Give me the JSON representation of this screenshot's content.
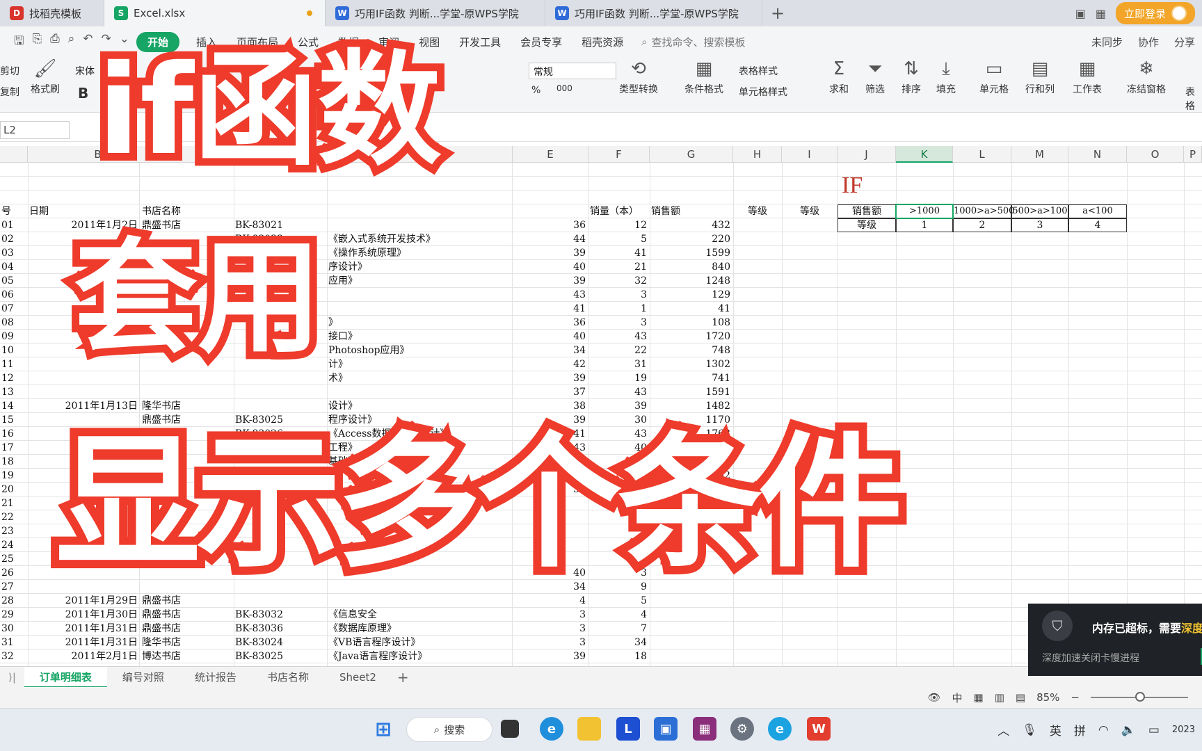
{
  "tabs": [
    {
      "label": "找稻壳模板",
      "icon": "D",
      "color": "#d9342b"
    },
    {
      "label": "Excel.xlsx",
      "icon": "S",
      "color": "#16a564"
    },
    {
      "label": "巧用IF函数 判断...学堂-原WPS学院",
      "icon": "W",
      "color": "#2f6bd8"
    },
    {
      "label": "巧用IF函数 判断...学堂-原WPS学院",
      "icon": "W",
      "color": "#2f6bd8"
    }
  ],
  "login_label": "立即登录",
  "menu": [
    "开始",
    "插入",
    "页面布局",
    "公式",
    "数据",
    "审阅",
    "视图",
    "开发工具",
    "会员专享",
    "稻壳资源"
  ],
  "search_placeholder": "查找命令、搜索模板",
  "menu_right": [
    "未同步",
    "协作",
    "分享"
  ],
  "ribbon": {
    "cut": "剪切",
    "copy": "复制",
    "format_painter": "格式刷",
    "font": "宋体",
    "bold": "B",
    "number_format": "常规",
    "type_convert": "类型转换",
    "cond_format": "条件格式",
    "table_style": "表格样式",
    "cell_style": "单元格样式",
    "sum": "求和",
    "filter": "筛选",
    "sort": "排序",
    "fill": "填充",
    "cell": "单元格",
    "row_col": "行和列",
    "worksheet": "工作表",
    "freeze": "冻结窗格",
    "table": "表格",
    "pct": "%",
    "thousand": "000"
  },
  "name_box": "L2",
  "columns": [
    "B",
    "E",
    "F",
    "G",
    "H",
    "I",
    "J",
    "K",
    "L",
    "M",
    "N",
    "O",
    "P"
  ],
  "header_row": {
    "a": "号",
    "b": "日期",
    "c": "书店名称",
    "g": "销量（本）",
    "h": "销售额",
    "i": "等级",
    "j": "等级"
  },
  "rows": [
    {
      "a": "01",
      "b": "2011年1月2日",
      "c": "鼎盛书店",
      "d": "BK-83021",
      "e": "",
      "f": "36",
      "g": "12",
      "h": "432"
    },
    {
      "a": "02",
      "b": "",
      "c": "",
      "d": "BK-83033",
      "e": "《嵌入式系统开发技术》",
      "f": "44",
      "g": "5",
      "h": "220"
    },
    {
      "a": "03",
      "b": "",
      "c": "",
      "d": "",
      "e": "《操作系统原理》",
      "f": "39",
      "g": "41",
      "h": "1599"
    },
    {
      "a": "04",
      "b": "",
      "c": "",
      "d": "",
      "e": "序设计》",
      "f": "40",
      "g": "21",
      "h": "840"
    },
    {
      "a": "05",
      "b": "",
      "c": "",
      "d": "",
      "e": "应用》",
      "f": "39",
      "g": "32",
      "h": "1248"
    },
    {
      "a": "06",
      "b": "",
      "c": "",
      "d": "",
      "e": "",
      "f": "43",
      "g": "3",
      "h": "129"
    },
    {
      "a": "07",
      "b": "",
      "c": "",
      "d": "",
      "e": "",
      "f": "41",
      "g": "1",
      "h": "41"
    },
    {
      "a": "08",
      "b": "",
      "c": "",
      "d": "",
      "e": "》",
      "f": "36",
      "g": "3",
      "h": "108"
    },
    {
      "a": "09",
      "b": "",
      "c": "",
      "d": "",
      "e": "接口》",
      "f": "40",
      "g": "43",
      "h": "1720"
    },
    {
      "a": "10",
      "b": "",
      "c": "",
      "d": "",
      "e": "Photoshop应用》",
      "f": "34",
      "g": "22",
      "h": "748"
    },
    {
      "a": "11",
      "b": "",
      "c": "",
      "d": "",
      "e": "计》",
      "f": "42",
      "g": "31",
      "h": "1302"
    },
    {
      "a": "12",
      "b": "",
      "c": "",
      "d": "",
      "e": "术》",
      "f": "39",
      "g": "19",
      "h": "741"
    },
    {
      "a": "13",
      "b": "",
      "c": "",
      "d": "",
      "e": "",
      "f": "37",
      "g": "43",
      "h": "1591"
    },
    {
      "a": "14",
      "b": "2011年1月13日",
      "c": "隆华书店",
      "d": "",
      "e": "设计》",
      "f": "38",
      "g": "39",
      "h": "1482"
    },
    {
      "a": "15",
      "b": "",
      "c": "鼎盛书店",
      "d": "BK-83025",
      "e": "程序设计》",
      "f": "39",
      "g": "30",
      "h": "1170"
    },
    {
      "a": "16",
      "b": "",
      "c": "",
      "d": "BK-83026",
      "e": "《Access数据库程序设计》",
      "f": "41",
      "g": "43",
      "h": "1763"
    },
    {
      "a": "17",
      "b": "",
      "c": "",
      "d": "",
      "e": "工程》",
      "f": "43",
      "g": "40",
      "h": "1720"
    },
    {
      "a": "18",
      "b": "",
      "c": "",
      "d": "",
      "e": "基础及MS",
      "f": "36",
      "g": "44",
      "h": "1584"
    },
    {
      "a": "19",
      "b": "",
      "c": "",
      "d": "",
      "e": "",
      "f": "44",
      "g": "33",
      "h": "1452"
    },
    {
      "a": "20",
      "b": "",
      "c": "",
      "d": "",
      "e": "",
      "f": "39",
      "g": "",
      "h": "1365"
    },
    {
      "a": "21",
      "b": "",
      "c": "",
      "d": "",
      "e": "",
      "f": "",
      "g": "",
      "h": "88"
    },
    {
      "a": "22",
      "b": "",
      "c": "",
      "d": "",
      "e": "",
      "f": "",
      "g": "",
      "h": ""
    },
    {
      "a": "23",
      "b": "",
      "c": "",
      "d": "",
      "e": "",
      "f": "",
      "g": "",
      "h": ""
    },
    {
      "a": "24",
      "b": "",
      "c": "",
      "d": "",
      "e": "",
      "f": "",
      "g": "",
      "h": ""
    },
    {
      "a": "25",
      "b": "",
      "c": "",
      "d": "",
      "e": "",
      "f": "",
      "g": "",
      "h": ""
    },
    {
      "a": "26",
      "b": "",
      "c": "",
      "d": "",
      "e": "",
      "f": "40",
      "g": "3",
      "h": ""
    },
    {
      "a": "27",
      "b": "",
      "c": "",
      "d": "",
      "e": "",
      "f": "34",
      "g": "9",
      "h": ""
    },
    {
      "a": "28",
      "b": "2011年1月29日",
      "c": "鼎盛书店",
      "d": "",
      "e": "",
      "f": "4",
      "g": "5",
      "h": ""
    },
    {
      "a": "29",
      "b": "2011年1月30日",
      "c": "鼎盛书店",
      "d": "BK-83032",
      "e": "《信息安全",
      "f": "3",
      "g": "4",
      "h": ""
    },
    {
      "a": "30",
      "b": "2011年1月31日",
      "c": "鼎盛书店",
      "d": "BK-83036",
      "e": "《数据库原理》",
      "f": "3",
      "g": "7",
      "h": ""
    },
    {
      "a": "31",
      "b": "2011年1月31日",
      "c": "隆华书店",
      "d": "BK-83024",
      "e": "《VB语言程序设计》",
      "f": "3",
      "g": "34",
      "h": ""
    },
    {
      "a": "32",
      "b": "2011年2月1日",
      "c": "博达书店",
      "d": "BK-83025",
      "e": "《Java语言程序设计》",
      "f": "39",
      "g": "18",
      "h": ""
    }
  ],
  "if_title": "IF",
  "criteria": {
    "row1": [
      "销售额",
      ">1000",
      "1000>a>500",
      "500>a>100",
      "a<100"
    ],
    "row2": [
      "等级",
      "1",
      "2",
      "3",
      "4"
    ]
  },
  "sheets": [
    "订单明细表",
    "编号对照",
    "统计报告",
    "书店名称",
    "Sheet2"
  ],
  "zoom": "85%",
  "taskbar_search": "搜索",
  "tray": [
    "英",
    "拼"
  ],
  "tray_year": "2023",
  "toast": {
    "msg": "内存已超标，需要",
    "msg_tail": "深度",
    "sub": "深度加速关闭卡慢进程"
  },
  "overlay": {
    "line1": "if函数",
    "line2": "套用",
    "line3": "显示多个条件"
  }
}
